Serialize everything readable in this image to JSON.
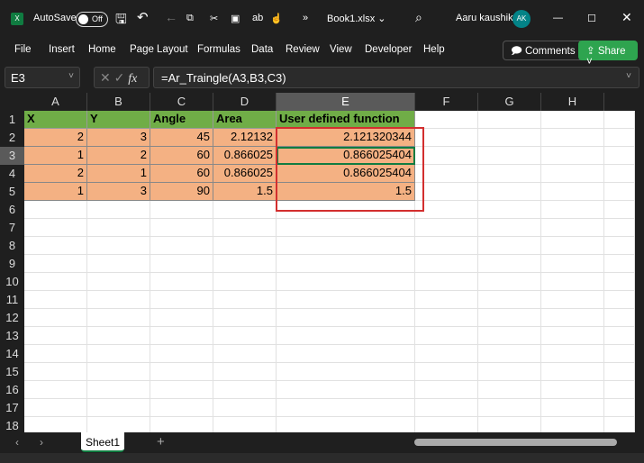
{
  "titlebar": {
    "autosave": "AutoSave",
    "toggle": "Off",
    "filename": "Book1.xlsx ⌄",
    "user": "Aaru kaushik",
    "avatar": "AK",
    "more": "»"
  },
  "menu": [
    "File",
    "Insert",
    "Home",
    "Page Layout",
    "Formulas",
    "Data",
    "Review",
    "View",
    "Developer",
    "Help"
  ],
  "comments": "Comments",
  "share": "Share",
  "name_box": "E3",
  "fx": "fx",
  "formula": "=Ar_Traingle(A3,B3,C3)",
  "columns": [
    "A",
    "B",
    "C",
    "D",
    "E",
    "F",
    "G",
    "H"
  ],
  "selected_column": "E",
  "selected_row": 3,
  "rows": [
    "1",
    "2",
    "3",
    "4",
    "5",
    "6",
    "7",
    "8",
    "9",
    "10",
    "11",
    "12",
    "13",
    "14",
    "15",
    "16",
    "17",
    "18"
  ],
  "headers": [
    "X",
    "Y",
    "Angle",
    "Area",
    "User defined function"
  ],
  "data": [
    [
      "2",
      "3",
      "45",
      "2.12132",
      "2.121320344"
    ],
    [
      "1",
      "2",
      "60",
      "0.866025",
      "0.866025404"
    ],
    [
      "2",
      "1",
      "60",
      "0.866025",
      "0.866025404"
    ],
    [
      "1",
      "3",
      "90",
      "1.5",
      "1.5"
    ]
  ],
  "colors": {
    "header_fill": "#70ad47",
    "data_fill": "#f4b183",
    "highlight_box": "#d32f2f",
    "accent": "#107c41"
  },
  "sheet_tab": "Sheet1",
  "add_sheet": "+"
}
